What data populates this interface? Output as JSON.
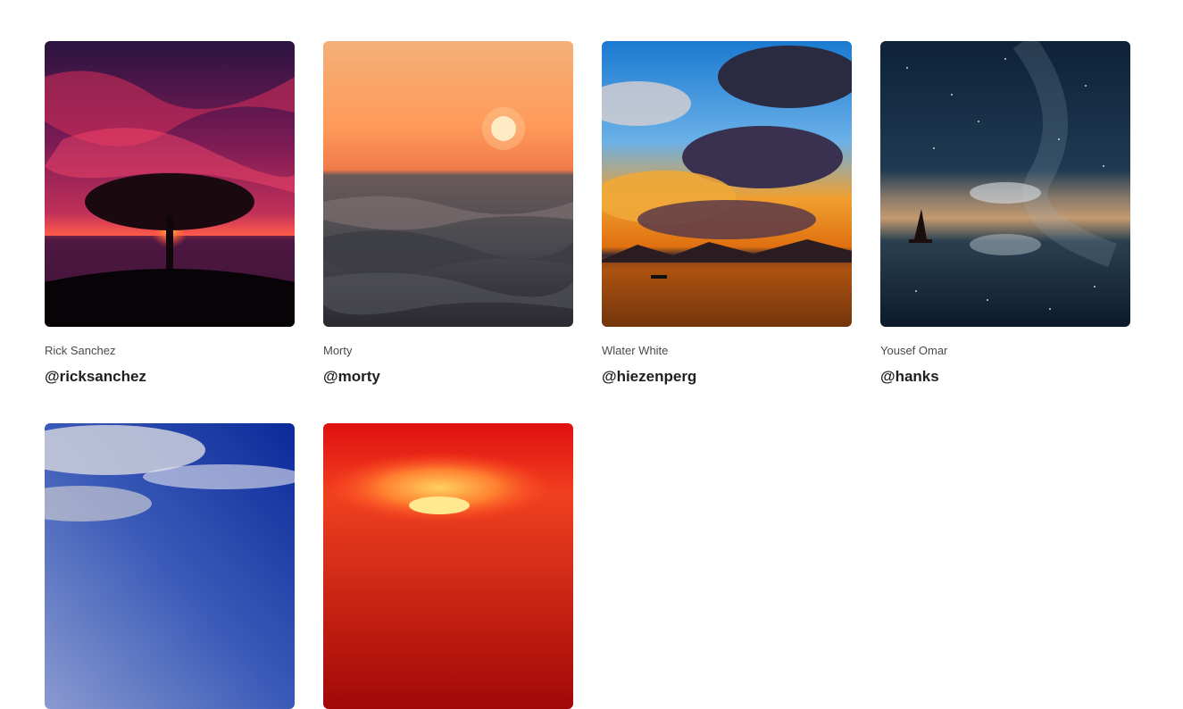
{
  "profiles": [
    {
      "name": "Rick Sanchez",
      "handle": "@ricksanchez",
      "image": "tree-sunset-image"
    },
    {
      "name": "Morty",
      "handle": "@morty",
      "image": "ocean-wave-sunset-image"
    },
    {
      "name": "Wlater White",
      "handle": "@hiezenperg",
      "image": "cloudy-sunset-lake-image"
    },
    {
      "name": "Yousef Omar",
      "handle": "@hanks",
      "image": "starry-sailboat-image"
    },
    {
      "image": "cloudy-blue-sky-image"
    },
    {
      "image": "red-sun-image"
    }
  ]
}
